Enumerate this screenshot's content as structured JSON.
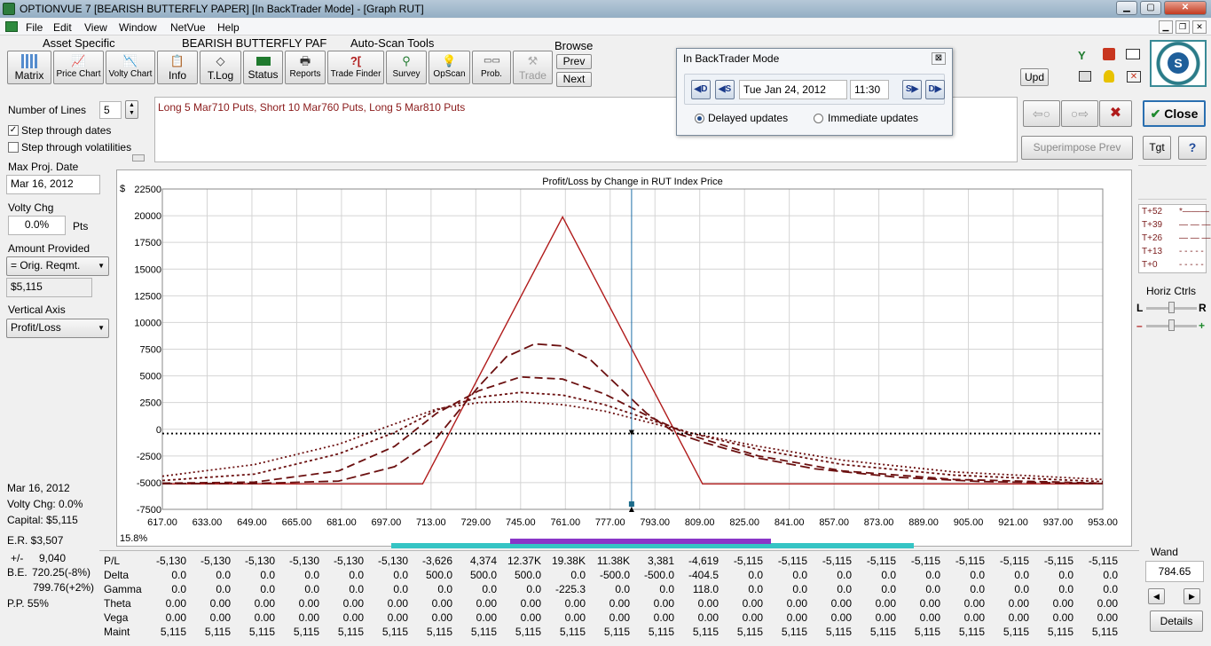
{
  "window": {
    "title": "OPTIONVUE 7   [BEARISH BUTTERFLY PAPER]   [In BackTrader Mode] - [Graph RUT]",
    "minimize": "▁",
    "maximize": "▢",
    "close": "✕",
    "mdi_minimize": "▁",
    "mdi_restore": "❐",
    "mdi_close": "✕"
  },
  "menu": [
    "File",
    "Edit",
    "View",
    "Window",
    "NetVue",
    "Help"
  ],
  "toolbar": {
    "group_asset": "Asset Specific",
    "group_position": "BEARISH BUTTERFLY PAF",
    "group_autoscan": "Auto-Scan Tools",
    "group_browse": "Browse",
    "buttons": {
      "matrix": "Matrix",
      "price_chart": "Price Chart",
      "volty_chart": "Volty Chart",
      "info": "Info",
      "tlog": "T.Log",
      "status": "Status",
      "reports": "Reports",
      "trade_finder": "Trade Finder",
      "survey": "Survey",
      "opscan": "OpScan",
      "prob": "Prob.",
      "trade": "Trade"
    },
    "browse_prev": "Prev",
    "browse_next": "Next",
    "upd": "Upd",
    "yahoo_icon": "Y",
    "logo_letter": "S"
  },
  "left": {
    "num_lines_label": "Number of Lines",
    "num_lines_value": "5",
    "step_dates_label": "Step through dates",
    "step_dates_checked": "✓",
    "step_vols_label": "Step through volatilities",
    "max_proj_label": "Max Proj. Date",
    "max_proj_value": "Mar 16, 2012",
    "volty_label": "Volty Chg",
    "volty_value": "0.0%",
    "volty_unit": "Pts",
    "amount_label": "Amount Provided",
    "amount_option": "= Orig. Reqmt.",
    "amount_value": "$5,115",
    "vaxis_label": "Vertical Axis",
    "vaxis_option": "Profit/Loss",
    "bottom_date": "Mar 16, 2012",
    "bottom_volty": "Volty Chg:  0.0%",
    "bottom_capital": "Capital:  $5,115",
    "er": "E.R. $3,507",
    "pct": "15.8%",
    "pm_label": "+/-",
    "pm_value": "9,040",
    "be_label": "B.E.",
    "be_value1": "720.25(-8%)",
    "be_value2": "799.76(+2%)",
    "pp": "P.P.  55%"
  },
  "position_text": "Long 5 Mar710 Puts, Short 10 Mar760 Puts, Long 5 Mar810 Puts",
  "popup": {
    "title": "In BackTrader Mode",
    "close": "⊠",
    "btn_md": "◀D",
    "btn_ms": "◀S",
    "btn_sf": "S▶",
    "btn_df": "D▶",
    "date": "Tue Jan 24, 2012",
    "time": "11:30",
    "delayed": "Delayed updates",
    "immediate": "Immediate updates"
  },
  "right": {
    "back_arrow": "⇦○",
    "fwd_arrow": "○⇨",
    "x_button": "✖",
    "close_label": "Close",
    "close_check": "✔",
    "superimpose": "Superimpose Prev",
    "tgt": "Tgt",
    "help": "?",
    "horiz_ctrls": "Horiz Ctrls",
    "left_L": "L",
    "right_R": "R",
    "minus": "–",
    "plus": "+",
    "wand_label": "Wand",
    "wand_value": "784.65",
    "details": "Details",
    "nav_left": "◀",
    "nav_right": "▶"
  },
  "legend": [
    {
      "label": "T+52",
      "style": "*———"
    },
    {
      "label": "T+39",
      "style": "— — —"
    },
    {
      "label": "T+26",
      "style": "— — —"
    },
    {
      "label": "T+13",
      "style": "- - - - -"
    },
    {
      "label": "T+0",
      "style": "- - - - -"
    }
  ],
  "chart_data": {
    "type": "line",
    "title": "Profit/Loss by Change in RUT Index Price",
    "ylabel": "$",
    "xlim": [
      617,
      953
    ],
    "ylim": [
      -7500,
      22500
    ],
    "xticks": [
      "617.00",
      "633.00",
      "649.00",
      "665.00",
      "681.00",
      "697.00",
      "713.00",
      "729.00",
      "745.00",
      "761.00",
      "777.00",
      "793.00",
      "809.00",
      "825.00",
      "841.00",
      "857.00",
      "873.00",
      "889.00",
      "905.00",
      "921.00",
      "937.00",
      "953.00"
    ],
    "yticks": [
      "22500",
      "20000",
      "17500",
      "15000",
      "12500",
      "10000",
      "7500",
      "5000",
      "2500",
      "0",
      "-2500",
      "-5000",
      "-7500"
    ],
    "grid": true,
    "cursor_x": 784.65,
    "series": [
      {
        "name": "T+52",
        "color": "#b01b1b",
        "dash": "",
        "x": [
          617,
          710,
          760,
          810,
          953
        ],
        "y": [
          -5115,
          -5115,
          19885,
          -5115,
          -5115
        ]
      },
      {
        "name": "T+39",
        "color": "#6b1010",
        "dash": "11,5",
        "x": [
          617,
          650,
          680,
          700,
          715,
          730,
          740,
          750,
          760,
          770,
          780,
          790,
          800,
          810,
          830,
          850,
          880,
          910,
          953
        ],
        "y": [
          -5100,
          -5080,
          -4850,
          -3500,
          -800,
          4000,
          6800,
          8000,
          7800,
          6500,
          4000,
          1500,
          -300,
          -1200,
          -2700,
          -3700,
          -4500,
          -4900,
          -5100
        ]
      },
      {
        "name": "T+26",
        "color": "#6b1010",
        "dash": "9,5",
        "x": [
          617,
          650,
          680,
          700,
          715,
          730,
          745,
          760,
          775,
          790,
          805,
          830,
          860,
          900,
          953
        ],
        "y": [
          -5050,
          -4950,
          -3900,
          -1600,
          1500,
          3600,
          4900,
          4700,
          3300,
          1300,
          -500,
          -2500,
          -3900,
          -4700,
          -5050
        ]
      },
      {
        "name": "T+13",
        "color": "#6b1010",
        "dash": "3,3",
        "x": [
          617,
          650,
          680,
          700,
          715,
          730,
          745,
          760,
          775,
          790,
          805,
          830,
          860,
          900,
          953
        ],
        "y": [
          -4800,
          -4200,
          -2300,
          -300,
          1800,
          3000,
          3450,
          3200,
          2300,
          1000,
          -300,
          -1900,
          -3300,
          -4300,
          -4900
        ]
      },
      {
        "name": "T+0",
        "color": "#6b1010",
        "dash": "2,3",
        "x": [
          617,
          650,
          680,
          700,
          715,
          730,
          745,
          760,
          775,
          790,
          805,
          830,
          860,
          900,
          953
        ],
        "y": [
          -4400,
          -3300,
          -1400,
          500,
          1900,
          2500,
          2600,
          2300,
          1700,
          700,
          -300,
          -1600,
          -2900,
          -4000,
          -4700
        ]
      },
      {
        "name": "",
        "color": "#000000",
        "dash": "2,3",
        "x": [
          617,
          953
        ],
        "y": [
          -400,
          -400
        ]
      }
    ]
  },
  "grid_table": {
    "row_labels": [
      "P/L",
      "Delta",
      "Gamma",
      "Theta",
      "Vega",
      "Maint"
    ],
    "rows": [
      [
        "-5,130",
        "-5,130",
        "-5,130",
        "-5,130",
        "-5,130",
        "-5,130",
        "-3,626",
        "4,374",
        "12.37K",
        "19.38K",
        "11.38K",
        "3,381",
        "-4,619",
        "-5,115",
        "-5,115",
        "-5,115",
        "-5,115",
        "-5,115",
        "-5,115",
        "-5,115",
        "-5,115",
        "-5,115"
      ],
      [
        "0.0",
        "0.0",
        "0.0",
        "0.0",
        "0.0",
        "0.0",
        "500.0",
        "500.0",
        "500.0",
        "0.0",
        "-500.0",
        "-500.0",
        "-404.5",
        "0.0",
        "0.0",
        "0.0",
        "0.0",
        "0.0",
        "0.0",
        "0.0",
        "0.0",
        "0.0"
      ],
      [
        "0.0",
        "0.0",
        "0.0",
        "0.0",
        "0.0",
        "0.0",
        "0.0",
        "0.0",
        "0.0",
        "-225.3",
        "0.0",
        "0.0",
        "118.0",
        "0.0",
        "0.0",
        "0.0",
        "0.0",
        "0.0",
        "0.0",
        "0.0",
        "0.0",
        "0.0"
      ],
      [
        "0.00",
        "0.00",
        "0.00",
        "0.00",
        "0.00",
        "0.00",
        "0.00",
        "0.00",
        "0.00",
        "0.00",
        "0.00",
        "0.00",
        "0.00",
        "0.00",
        "0.00",
        "0.00",
        "0.00",
        "0.00",
        "0.00",
        "0.00",
        "0.00",
        "0.00"
      ],
      [
        "0.00",
        "0.00",
        "0.00",
        "0.00",
        "0.00",
        "0.00",
        "0.00",
        "0.00",
        "0.00",
        "0.00",
        "0.00",
        "0.00",
        "0.00",
        "0.00",
        "0.00",
        "0.00",
        "0.00",
        "0.00",
        "0.00",
        "0.00",
        "0.00",
        "0.00"
      ],
      [
        "5,115",
        "5,115",
        "5,115",
        "5,115",
        "5,115",
        "5,115",
        "5,115",
        "5,115",
        "5,115",
        "5,115",
        "5,115",
        "5,115",
        "5,115",
        "5,115",
        "5,115",
        "5,115",
        "5,115",
        "5,115",
        "5,115",
        "5,115",
        "5,115",
        "5,115"
      ]
    ]
  },
  "colors": {
    "accent": "#2e8b3e",
    "pl_line": "#b01b1b",
    "cyan_bar": "#35c4c4",
    "purple_bar": "#8a35c8",
    "cursor": "#1f6fa8"
  }
}
